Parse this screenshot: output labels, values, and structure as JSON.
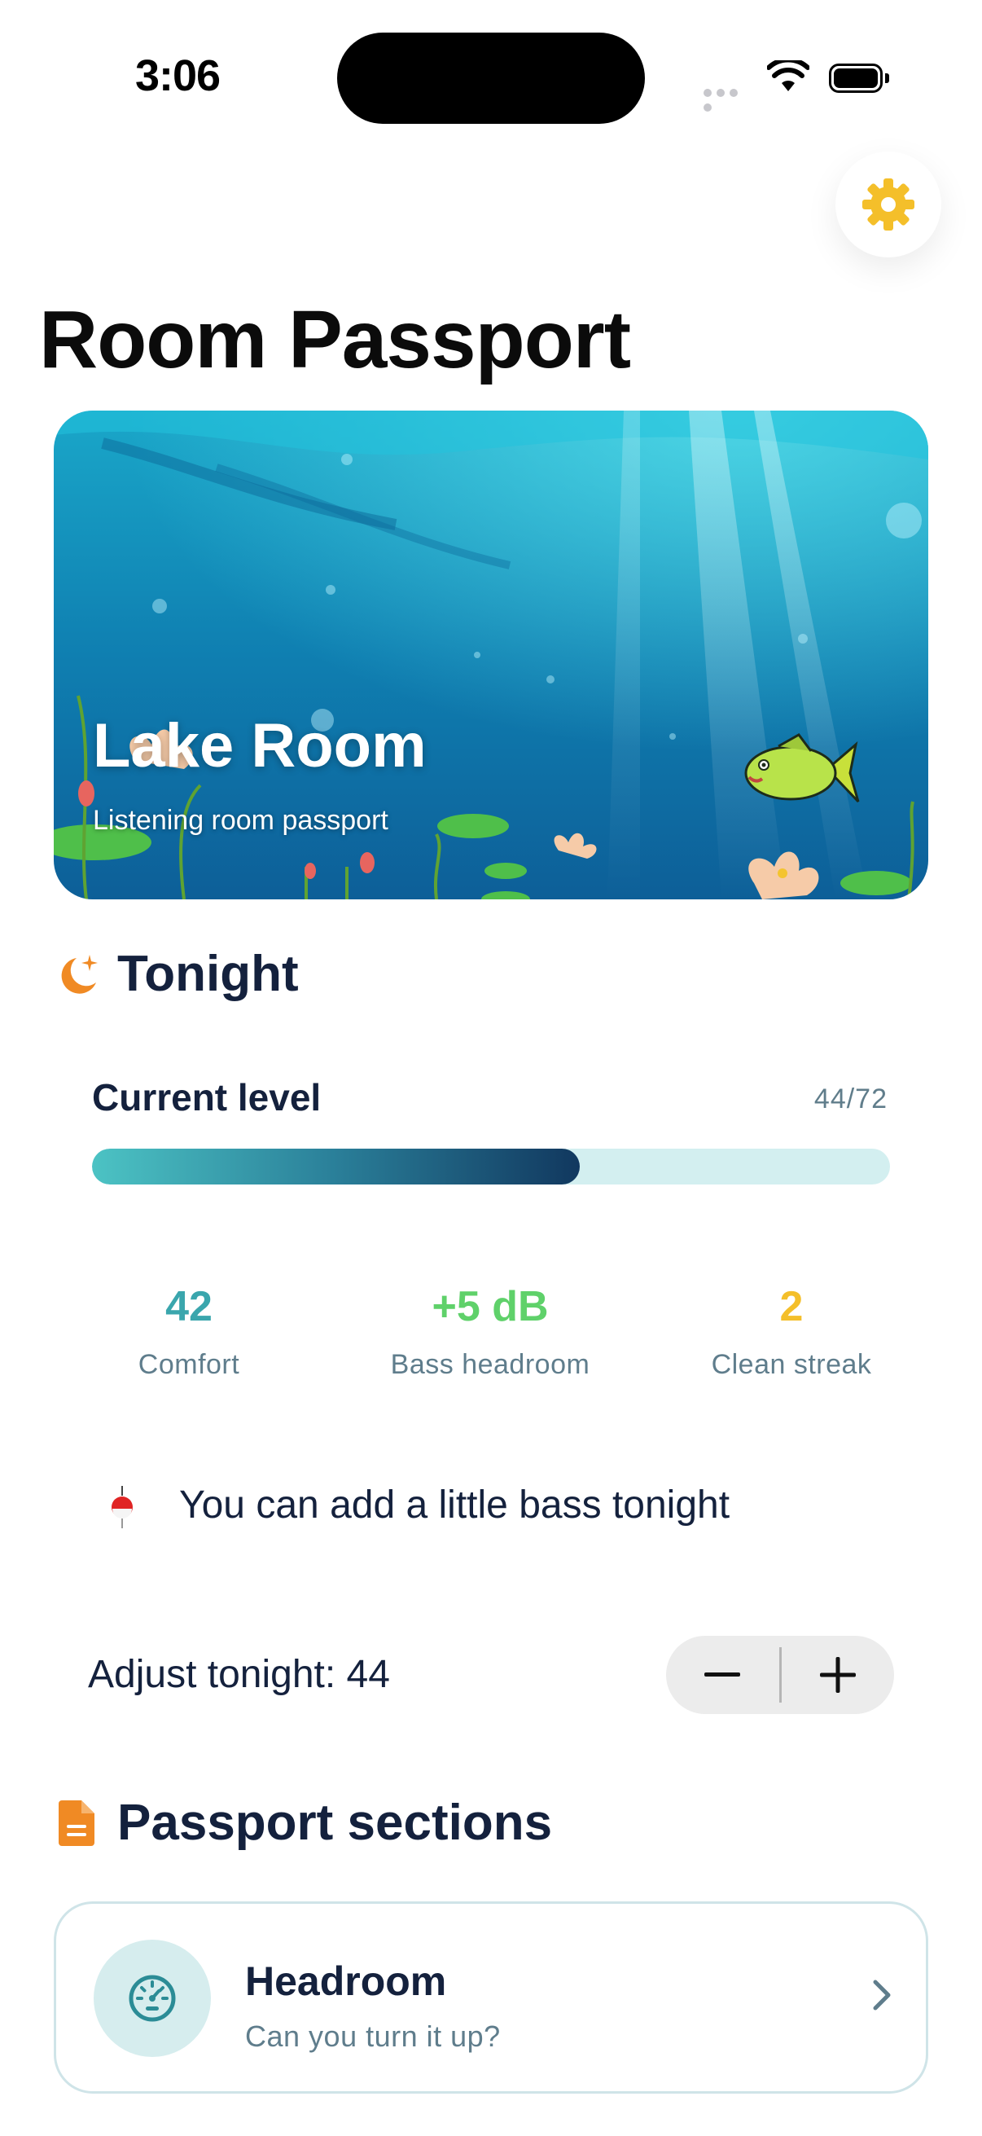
{
  "status_bar": {
    "time": "3:06"
  },
  "header": {
    "title": "Room Passport"
  },
  "hero": {
    "title": "Lake Room",
    "subtitle": "Listening room passport"
  },
  "tonight": {
    "title": "Tonight",
    "level_label": "Current level",
    "level_count": "44/72",
    "level_value": 44,
    "level_max": 72,
    "stats": [
      {
        "value": "42",
        "label": "Comfort",
        "color": "#3aa6ad"
      },
      {
        "value": "+5 dB",
        "label": "Bass headroom",
        "color": "#5fd16a"
      },
      {
        "value": "2",
        "label": "Clean streak",
        "color": "#f4bf2a"
      }
    ],
    "hint": "You can add a little bass tonight",
    "adjust_label": "Adjust tonight: 44"
  },
  "sections": {
    "title": "Passport sections",
    "items": [
      {
        "title": "Headroom",
        "subtitle": "Can you turn it up?",
        "icon": "gauge-icon"
      }
    ]
  },
  "colors": {
    "accent_orange": "#f08a24",
    "settings_gear": "#f4bf2a",
    "navy": "#14213d"
  }
}
